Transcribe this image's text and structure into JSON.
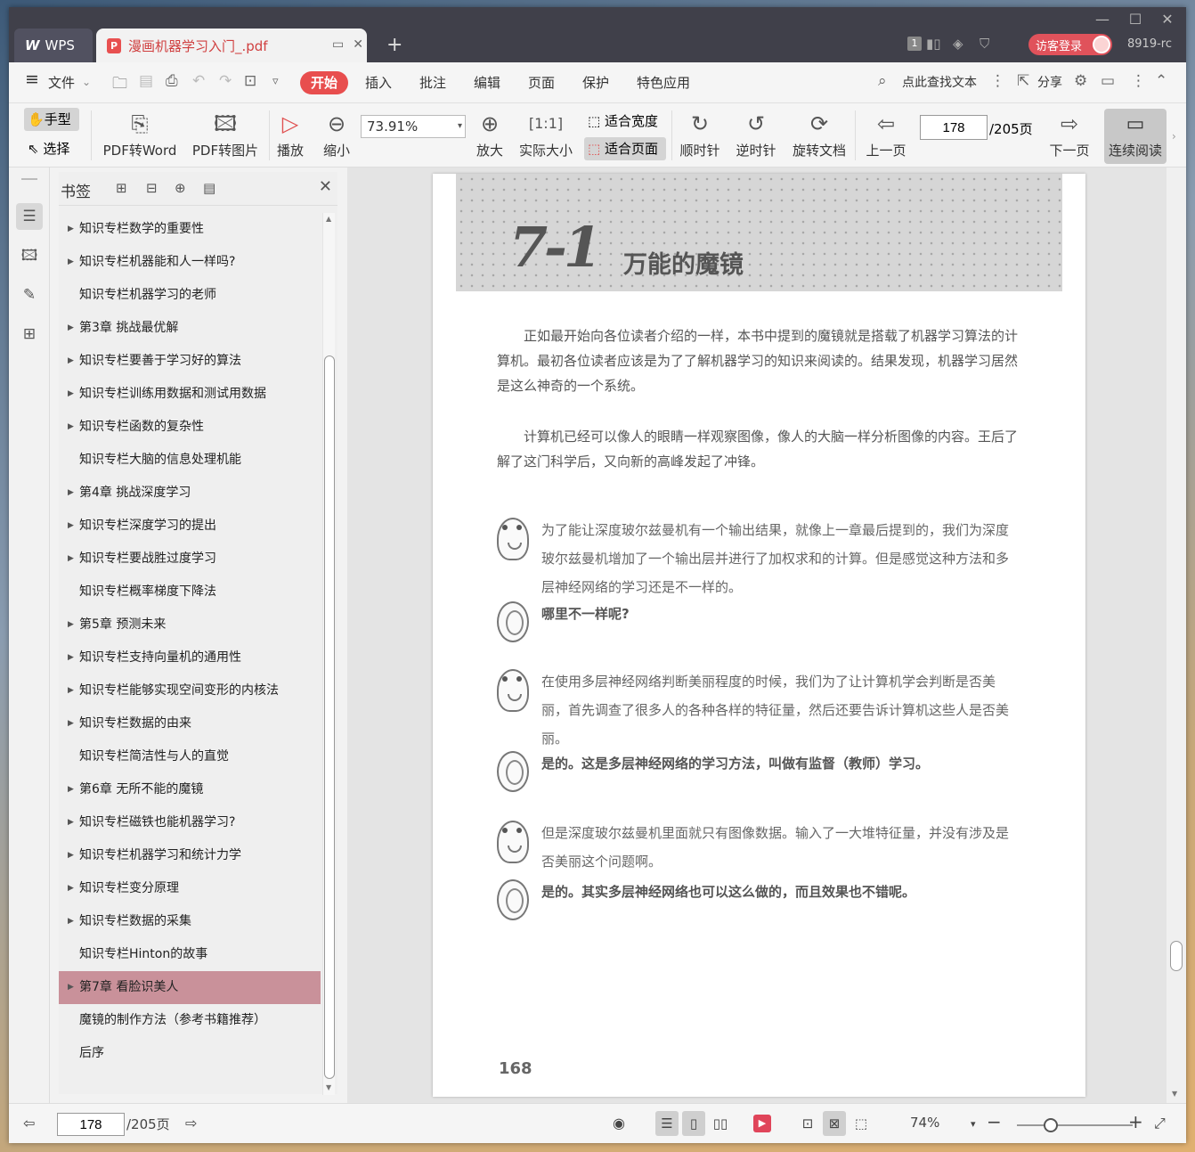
{
  "titlebar": {
    "wps_tab": "WPS",
    "pdf_tab": "漫画机器学习入门_.pdf",
    "pdf_badge": "P",
    "new_tab": "+",
    "count": "1",
    "login": "访客登录",
    "build": "8919-rc",
    "minimize": "—",
    "maximize": "☐",
    "close": "✕"
  },
  "menu": {
    "hamburger": "≡",
    "file": "文件",
    "start": "开始",
    "insert": "插入",
    "annotate": "批注",
    "edit": "编辑",
    "page": "页面",
    "protect": "保护",
    "special": "特色应用",
    "search": "点此查找文本",
    "share": "分享"
  },
  "toolbar": {
    "hand": "手型",
    "select": "选择",
    "pdf2word": "PDF转Word",
    "pdf2img": "PDF转图片",
    "play": "播放",
    "zoom_out": "缩小",
    "zoom_value": "73.91%",
    "zoom_in": "放大",
    "actual": "实际大小",
    "fit_width": "适合宽度",
    "fit_page": "适合页面",
    "cw": "顺时针",
    "ccw": "逆时针",
    "rotate": "旋转文档",
    "prev": "上一页",
    "page": "178",
    "total": "/205页",
    "next": "下一页",
    "continuous": "连续阅读"
  },
  "bookmarks": {
    "title": "书签",
    "close": "✕",
    "items": [
      {
        "label": "知识专栏数学的重要性",
        "arrow": true
      },
      {
        "label": "知识专栏机器能和人一样吗?",
        "arrow": true
      },
      {
        "label": "知识专栏机器学习的老师",
        "arrow": false
      },
      {
        "label": "第3章 挑战最优解",
        "arrow": true
      },
      {
        "label": "知识专栏要善于学习好的算法",
        "arrow": true
      },
      {
        "label": "知识专栏训练用数据和测试用数据",
        "arrow": true
      },
      {
        "label": "知识专栏函数的复杂性",
        "arrow": true
      },
      {
        "label": "知识专栏大脑的信息处理机能",
        "arrow": false
      },
      {
        "label": "第4章 挑战深度学习",
        "arrow": true
      },
      {
        "label": "知识专栏深度学习的提出",
        "arrow": true
      },
      {
        "label": "知识专栏要战胜过度学习",
        "arrow": true
      },
      {
        "label": "知识专栏概率梯度下降法",
        "arrow": false
      },
      {
        "label": "第5章 预测未来",
        "arrow": true
      },
      {
        "label": "知识专栏支持向量机的通用性",
        "arrow": true
      },
      {
        "label": "知识专栏能够实现空间变形的内核法",
        "arrow": true
      },
      {
        "label": "知识专栏数据的由来",
        "arrow": true
      },
      {
        "label": "知识专栏简洁性与人的直觉",
        "arrow": false
      },
      {
        "label": "第6章 无所不能的魔镜",
        "arrow": true
      },
      {
        "label": "知识专栏磁铁也能机器学习?",
        "arrow": true
      },
      {
        "label": "知识专栏机器学习和统计力学",
        "arrow": true
      },
      {
        "label": "知识专栏变分原理",
        "arrow": true
      },
      {
        "label": "知识专栏数据的采集",
        "arrow": true
      },
      {
        "label": "知识专栏Hinton的故事",
        "arrow": false
      },
      {
        "label": "第7章 看脸识美人",
        "arrow": true,
        "selected": true
      },
      {
        "label": "魔镜的制作方法（参考书籍推荐）",
        "arrow": false
      },
      {
        "label": "后序",
        "arrow": false
      }
    ]
  },
  "doc": {
    "chapter_num": "7-1",
    "chapter_title": "万能的魔镜",
    "para1": "正如最开始向各位读者介绍的一样，本书中提到的魔镜就是搭载了机器学习算法的计算机。最初各位读者应该是为了了解机器学习的知识来阅读的。结果发现，机器学习居然是这么神奇的一个系统。",
    "para2": "计算机已经可以像人的眼睛一样观察图像，像人的大脑一样分析图像的内容。王后了解了这门科学后，又向新的高峰发起了冲锋。",
    "dialog": [
      {
        "speaker": "girl",
        "text": "为了能让深度玻尔兹曼机有一个输出结果，就像上一章最后提到的，我们为深度玻尔兹曼机增加了一个输出层并进行了加权求和的计算。但是感觉这种方法和多层神经网络的学习还是不一样的。"
      },
      {
        "speaker": "mirror",
        "text": "哪里不一样呢?"
      },
      {
        "speaker": "girl",
        "text": "在使用多层神经网络判断美丽程度的时候，我们为了让计算机学会判断是否美丽，首先调查了很多人的各种各样的特征量，然后还要告诉计算机这些人是否美丽。"
      },
      {
        "speaker": "mirror",
        "text": "是的。这是多层神经网络的学习方法，叫做有监督（教师）学习。"
      },
      {
        "speaker": "girl",
        "text": "但是深度玻尔兹曼机里面就只有图像数据。输入了一大堆特征量，并没有涉及是否美丽这个问题啊。"
      },
      {
        "speaker": "mirror",
        "text": "是的。其实多层神经网络也可以这么做的，而且效果也不错呢。"
      }
    ],
    "page_number": "168"
  },
  "status": {
    "page": "178",
    "total": "/205页",
    "zoom": "74%"
  },
  "colors": {
    "accent": "#e84e4e",
    "titlebar": "#40404a",
    "selected_bookmark": "#c9919a"
  }
}
